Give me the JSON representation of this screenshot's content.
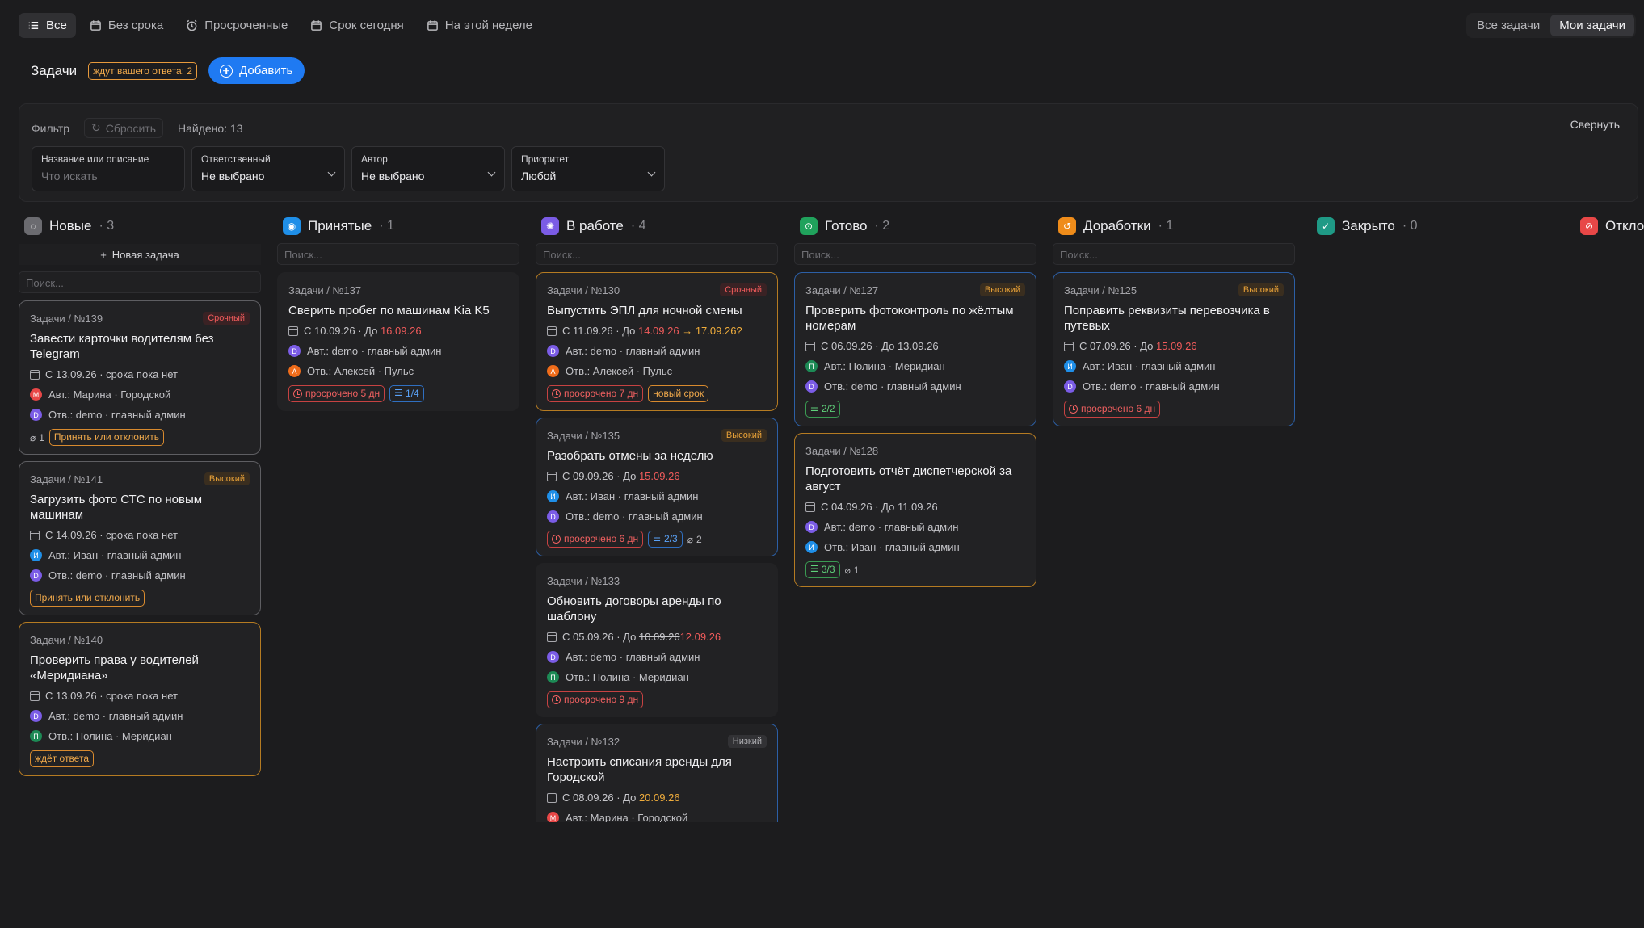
{
  "tabs": [
    {
      "label": "Все",
      "icon": "list-icon",
      "active": true
    },
    {
      "label": "Без срока",
      "icon": "calendar-icon"
    },
    {
      "label": "Просроченные",
      "icon": "alarm-icon"
    },
    {
      "label": "Срок сегодня",
      "icon": "calendar-icon"
    },
    {
      "label": "На этой неделе",
      "icon": "calendar-icon"
    }
  ],
  "scope": {
    "all": "Все задачи",
    "mine": "Мои задачи"
  },
  "header": {
    "title": "Задачи",
    "awaiting": "ждут вашего ответа: 2",
    "add": "Добавить"
  },
  "filter": {
    "label": "Фильтр",
    "reset": "Сбросить",
    "found": "Найдено: 13",
    "collapse": "Свернуть",
    "fields": [
      {
        "label": "Название или описание",
        "placeholder": "Что искать"
      },
      {
        "label": "Ответственный",
        "value": "Не выбрано"
      },
      {
        "label": "Автор",
        "value": "Не выбрано"
      },
      {
        "label": "Приоритет",
        "value": "Любой"
      }
    ]
  },
  "board": {
    "new_task": "Новая задача",
    "search_placeholder": "Поиск...",
    "columns": [
      {
        "name": "Новые",
        "count": "· 3",
        "color": "#6b6b70",
        "icon": "new-icon"
      },
      {
        "name": "Принятые",
        "count": "· 1",
        "color": "#1f8fe8",
        "icon": "accepted-icon"
      },
      {
        "name": "В работе",
        "count": "· 4",
        "color": "#7b5ce6",
        "icon": "in-progress-icon"
      },
      {
        "name": "Готово",
        "count": "· 2",
        "color": "#20a25c",
        "icon": "done-icon"
      },
      {
        "name": "Доработки",
        "count": "· 1",
        "color": "#ef8c1a",
        "icon": "rework-icon"
      },
      {
        "name": "Закрыто",
        "count": "· 0",
        "color": "#1f9a86",
        "icon": "closed-icon"
      },
      {
        "name": "Откло",
        "count": "",
        "color": "#e84747",
        "icon": "rejected-icon"
      }
    ]
  },
  "cards": {
    "c139": {
      "path": "Задачи / №139",
      "prio": "Срочный",
      "title": "Завести карточки водителям без Telegram",
      "dates": "С 13.09.26 · срока пока нет",
      "author": "Авт.: Марина · Городской",
      "assignee": "Отв.: demo · главный админ",
      "author_initial": "М",
      "assignee_initial": "D",
      "clips": "1",
      "action": "Принять или отклонить"
    },
    "c141": {
      "path": "Задачи / №141",
      "prio": "Высокий",
      "title": "Загрузить фото СТС по новым машинам",
      "dates": "С 14.09.26 · срока пока нет",
      "author": "Авт.: Иван · главный админ",
      "assignee": "Отв.: demo · главный админ",
      "author_initial": "И",
      "assignee_initial": "D",
      "action": "Принять или отклонить"
    },
    "c140": {
      "path": "Задачи / №140",
      "title": "Проверить права у водителей «Меридиана»",
      "dates": "С 13.09.26 · срока пока нет",
      "author": "Авт.: demo · главный админ",
      "assignee": "Отв.: Полина · Меридиан",
      "author_initial": "D",
      "assignee_initial": "П",
      "action": "ждёт ответа"
    },
    "c137": {
      "path": "Задачи / №137",
      "title": "Сверить пробег по машинам Kia K5",
      "date_from": "С 10.09.26 · До ",
      "date_to": "16.09.26",
      "author": "Авт.: demo · главный админ",
      "assignee": "Отв.: Алексей · Пульс",
      "author_initial": "D",
      "assignee_initial": "А",
      "overdue": "просрочено 5 дн",
      "checklist": "1/4"
    },
    "c130": {
      "path": "Задачи / №130",
      "prio": "Срочный",
      "title": "Выпустить ЭПЛ для ночной смены",
      "date_from": "С 11.09.26 · До ",
      "date_to": "14.09.26",
      "date_new": " → 17.09.26?",
      "author": "Авт.: demo · главный админ",
      "assignee": "Отв.: Алексей · Пульс",
      "author_initial": "D",
      "assignee_initial": "А",
      "overdue": "просрочено 7 дн",
      "extra": "новый срок"
    },
    "c135": {
      "path": "Задачи / №135",
      "prio": "Высокий",
      "title": "Разобрать отмены за неделю",
      "date_from": "С 09.09.26 · До ",
      "date_to": "15.09.26",
      "author": "Авт.: Иван · главный админ",
      "assignee": "Отв.: demo · главный админ",
      "author_initial": "И",
      "assignee_initial": "D",
      "overdue": "просрочено 6 дн",
      "checklist": "2/3",
      "clips": "2"
    },
    "c133": {
      "path": "Задачи / №133",
      "title": "Обновить договоры аренды по шаблону",
      "date_from": "С 05.09.26 · До ",
      "date_old": "10.09.26",
      "date_to": "12.09.26",
      "author": "Авт.: demo · главный админ",
      "assignee": "Отв.: Полина · Меридиан",
      "author_initial": "D",
      "assignee_initial": "П",
      "overdue": "просрочено 9 дн"
    },
    "c132": {
      "path": "Задачи / №132",
      "prio": "Низкий",
      "title": "Настроить списания аренды для Городской",
      "date_from": "С 08.09.26 · До ",
      "date_to": "20.09.26",
      "author": "Авт.: Марина · Городской",
      "author_initial": "М"
    },
    "c127": {
      "path": "Задачи / №127",
      "prio": "Высокий",
      "title": "Проверить фотоконтроль по жёлтым номерам",
      "dates": "С 06.09.26 · До 13.09.26",
      "author": "Авт.: Полина · Меридиан",
      "assignee": "Отв.: demo · главный админ",
      "author_initial": "П",
      "assignee_initial": "D",
      "checklist": "2/2"
    },
    "c128": {
      "path": "Задачи / №128",
      "title": "Подготовить отчёт диспетчерской за август",
      "dates": "С 04.09.26 · До 11.09.26",
      "author": "Авт.: demo · главный админ",
      "assignee": "Отв.: Иван · главный админ",
      "author_initial": "D",
      "assignee_initial": "И",
      "checklist": "3/3",
      "clips": "1"
    },
    "c125": {
      "path": "Задачи / №125",
      "prio": "Высокий",
      "title": "Поправить реквизиты перевозчика в путевых",
      "date_from": "С 07.09.26 · До ",
      "date_to": "15.09.26",
      "author": "Авт.: Иван · главный админ",
      "assignee": "Отв.: demo · главный админ",
      "author_initial": "И",
      "assignee_initial": "D",
      "overdue": "просрочено 6 дн"
    }
  },
  "colors": {
    "accent": "#1f7af2",
    "urgent": "#f05b5b",
    "high": "#e9a238",
    "avatar_d": "#7b5ce6",
    "avatar_m": "#e84747",
    "avatar_i": "#1f8fe8",
    "avatar_p": "#1d8a55",
    "avatar_a": "#ef6c1a"
  }
}
